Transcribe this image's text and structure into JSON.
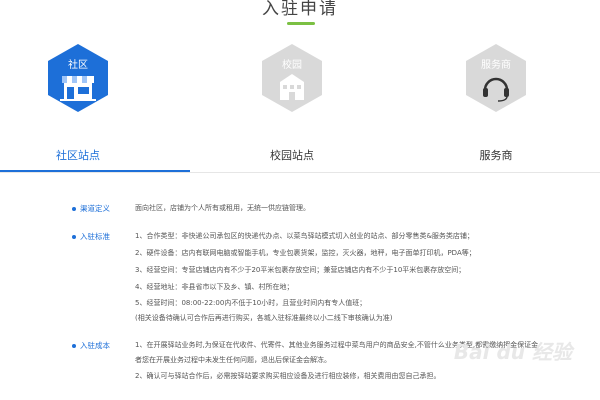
{
  "page": {
    "title": "入驻申请"
  },
  "tabs": [
    {
      "id": "community",
      "hex_label": "社区",
      "label": "社区站点",
      "active": true
    },
    {
      "id": "campus",
      "hex_label": "校园",
      "label": "校园站点",
      "active": false
    },
    {
      "id": "service",
      "hex_label": "服务商",
      "label": "服务商",
      "active": false
    }
  ],
  "colors": {
    "accent": "#1d6fd8",
    "underline": "#7bc043",
    "inactive_hex": "#d9d9d9"
  },
  "sections": [
    {
      "title": "渠道定义",
      "lines": [
        "面向社区，店铺为个人所有或租用，无统一供应链管理。"
      ]
    },
    {
      "title": "入驻标准",
      "lines": [
        "1、合作类型：非快递公司承包区的快递代办点、以菜鸟驿站模式切入创业的站点、部分零售类&服务类店铺；",
        "2、硬件设备：店内有联网电脑或智能手机，专业包裹货架，监控，灭火器，地秤，电子面单打印机，PDA等；",
        "3、经营空间：专营店铺店内有不少于20平米包裹存放空间；兼营店铺店内有不少于10平米包裹存放空间；",
        "4、经营地址：非县省市以下及乡、镇、村所在地；",
        "5、经营时间：08:00-22:00内不低于10小时，且营业时间内有专人值班；",
        "(相关设备待确认可合作后再进行购买，各城入驻标准最终以小二线下审核确认为准)"
      ]
    },
    {
      "title": "入驻成本",
      "lines": [
        "1、在开展驿站业务时,为保证在代收件、代寄件、其他业务服务过程中菜鸟用户的商品安全,不管什么业务类型,都需缴纳押金保证金",
        "者您在开展业务过程中未发生任何问题，退出后保证金会解冻。",
        "2、确认可与驿站合作后，必需按驿站要求购买相应设备及进行相应装修，相关费用由您自己承担。"
      ]
    }
  ],
  "watermark": "Bai du 经验"
}
